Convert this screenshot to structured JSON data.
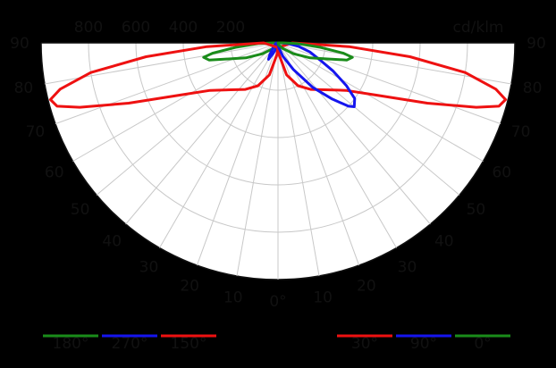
{
  "chart_data": {
    "type": "polar-luminous-intensity",
    "unit_label": "cd/klm",
    "radial_ticks": [
      "800",
      "600",
      "400",
      "200"
    ],
    "radial_max": 1000,
    "angle_labels_left": [
      "90",
      "80",
      "70",
      "60",
      "50",
      "40",
      "30",
      "20",
      "10",
      "0°"
    ],
    "angle_labels_right": [
      "90",
      "80",
      "70",
      "60",
      "50",
      "40",
      "30",
      "20",
      "10"
    ],
    "grid": true,
    "background": "#ffffff",
    "series": [
      {
        "name": "180°",
        "color": "#1a8c1a",
        "side": "left",
        "points": [
          [
            0,
            0
          ],
          [
            20,
            10
          ],
          [
            40,
            30
          ],
          [
            55,
            80
          ],
          [
            65,
            150
          ],
          [
            72,
            220
          ],
          [
            76,
            300
          ],
          [
            79,
            320
          ],
          [
            81,
            280
          ],
          [
            84,
            180
          ],
          [
            88,
            80
          ],
          [
            90,
            20
          ]
        ]
      },
      {
        "name": "270°",
        "color": "#1515ee",
        "side": "left",
        "points": [
          [
            0,
            0
          ],
          [
            10,
            10
          ],
          [
            20,
            30
          ],
          [
            25,
            50
          ],
          [
            30,
            80
          ],
          [
            35,
            60
          ],
          [
            45,
            30
          ],
          [
            60,
            15
          ],
          [
            75,
            10
          ],
          [
            90,
            5
          ]
        ]
      },
      {
        "name": "150°",
        "color": "#ee1111",
        "side": "left",
        "points": [
          [
            0,
            20
          ],
          [
            5,
            50
          ],
          [
            15,
            140
          ],
          [
            25,
            200
          ],
          [
            35,
            240
          ],
          [
            45,
            280
          ],
          [
            55,
            350
          ],
          [
            62,
            470
          ],
          [
            68,
            680
          ],
          [
            72,
            880
          ],
          [
            74,
            970
          ],
          [
            76,
            990
          ],
          [
            78,
            940
          ],
          [
            81,
            800
          ],
          [
            84,
            560
          ],
          [
            87,
            300
          ],
          [
            90,
            60
          ]
        ]
      },
      {
        "name": "30°",
        "color": "#ee1111",
        "side": "right",
        "points": [
          [
            0,
            20
          ],
          [
            5,
            50
          ],
          [
            15,
            140
          ],
          [
            25,
            200
          ],
          [
            35,
            240
          ],
          [
            45,
            280
          ],
          [
            55,
            350
          ],
          [
            62,
            470
          ],
          [
            68,
            680
          ],
          [
            72,
            880
          ],
          [
            74,
            970
          ],
          [
            76,
            990
          ],
          [
            78,
            940
          ],
          [
            81,
            800
          ],
          [
            84,
            560
          ],
          [
            87,
            300
          ],
          [
            90,
            60
          ]
        ]
      },
      {
        "name": "90°",
        "color": "#1515ee",
        "side": "right",
        "points": [
          [
            0,
            0
          ],
          [
            10,
            20
          ],
          [
            20,
            60
          ],
          [
            30,
            130
          ],
          [
            38,
            240
          ],
          [
            44,
            330
          ],
          [
            48,
            400
          ],
          [
            50,
            420
          ],
          [
            54,
            400
          ],
          [
            58,
            340
          ],
          [
            63,
            260
          ],
          [
            68,
            190
          ],
          [
            74,
            140
          ],
          [
            80,
            90
          ],
          [
            86,
            40
          ],
          [
            90,
            10
          ]
        ]
      },
      {
        "name": "0°",
        "color": "#1a8c1a",
        "side": "right",
        "points": [
          [
            0,
            0
          ],
          [
            20,
            10
          ],
          [
            40,
            30
          ],
          [
            55,
            80
          ],
          [
            65,
            150
          ],
          [
            72,
            220
          ],
          [
            76,
            300
          ],
          [
            79,
            320
          ],
          [
            81,
            280
          ],
          [
            84,
            180
          ],
          [
            88,
            80
          ],
          [
            90,
            20
          ]
        ]
      }
    ]
  }
}
